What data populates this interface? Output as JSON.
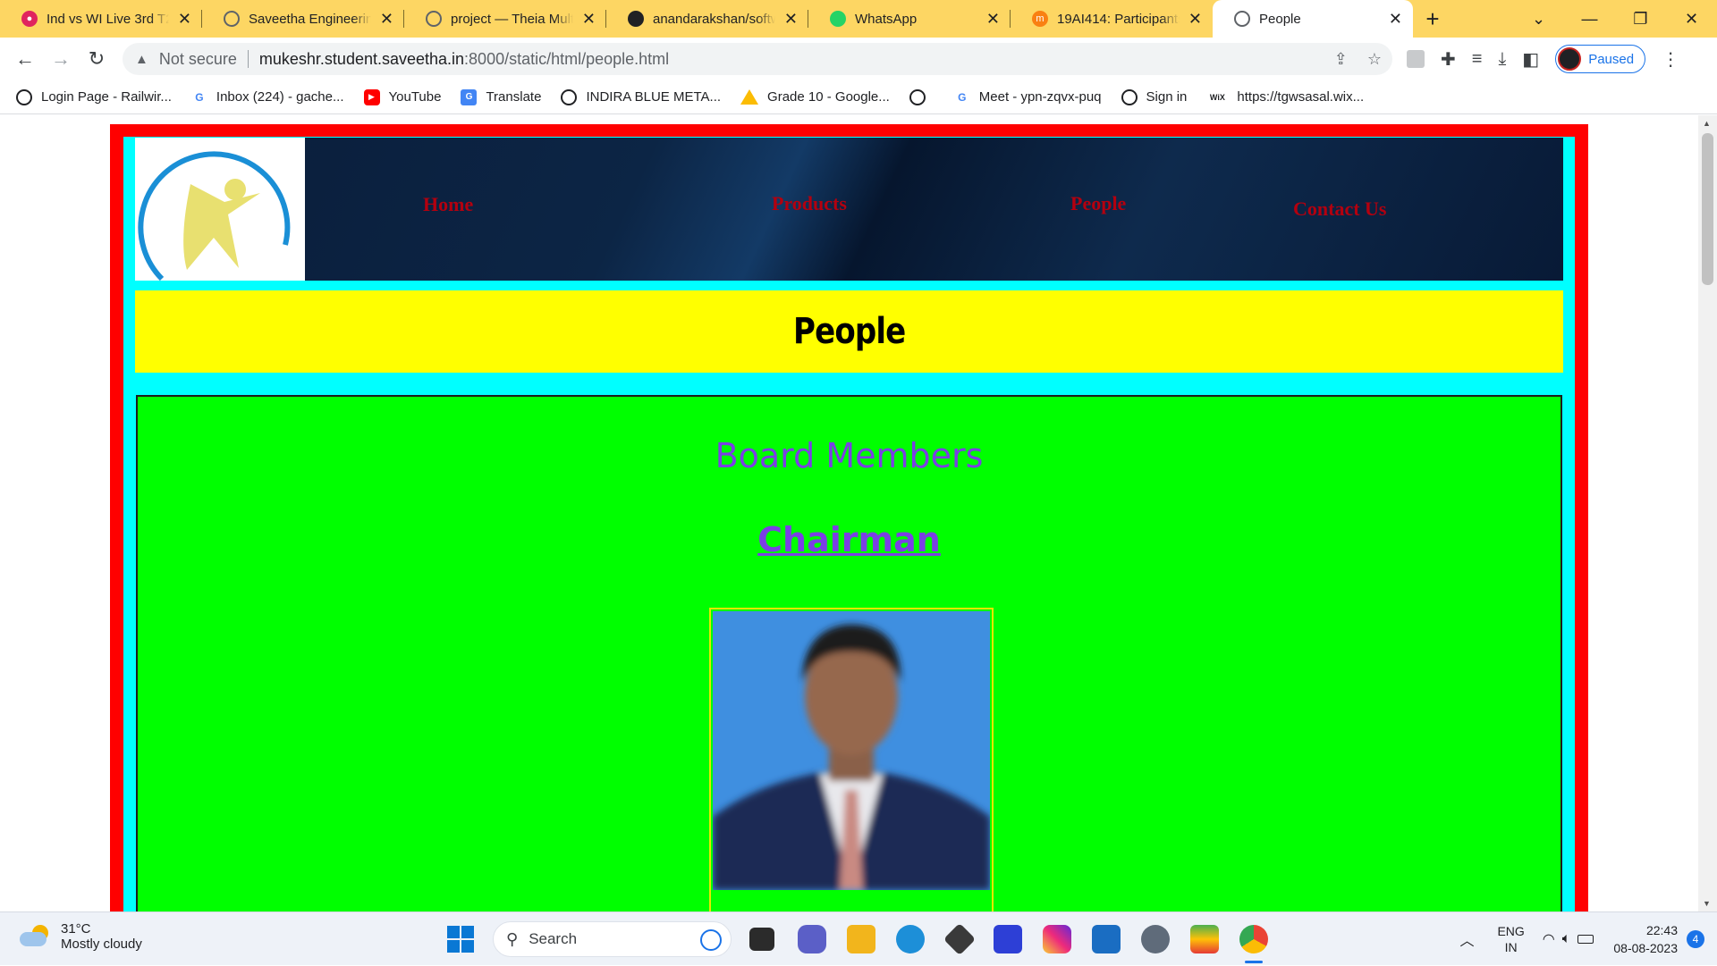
{
  "browser": {
    "tabs": [
      {
        "title": "Ind vs WI Live 3rd T20I",
        "icon": "cricket-icon",
        "color": "#e0245e"
      },
      {
        "title": "Saveetha Engineering",
        "icon": "globe-icon",
        "color": "#5f6368"
      },
      {
        "title": "project — Theia Multi",
        "icon": "globe-icon",
        "color": "#5f6368"
      },
      {
        "title": "anandarakshan/softw",
        "icon": "github-icon",
        "color": "#202124"
      },
      {
        "title": "WhatsApp",
        "icon": "whatsapp-icon",
        "color": "#25d366"
      },
      {
        "title": "19AI414: Participants",
        "icon": "moodle-icon",
        "color": "#f98012"
      },
      {
        "title": "People",
        "icon": "globe-icon",
        "color": "#5f6368"
      }
    ],
    "address": {
      "security_label": "Not secure",
      "host": "mukeshr.student.saveetha.in",
      "path": ":8000/static/html/people.html"
    },
    "profile_label": "Paused",
    "bookmarks": [
      {
        "label": "Login Page - Railwir...",
        "icon": "globe-icon"
      },
      {
        "label": "Inbox (224) - gache...",
        "icon": "google-icon"
      },
      {
        "label": "YouTube",
        "icon": "youtube-icon"
      },
      {
        "label": "Translate",
        "icon": "translate-icon"
      },
      {
        "label": "INDIRA BLUE META...",
        "icon": "globe-icon"
      },
      {
        "label": "Grade 10 - Google...",
        "icon": "drive-icon"
      },
      {
        "label": "",
        "icon": "globe-icon"
      },
      {
        "label": "Meet - ypn-zqvx-puq",
        "icon": "google-icon"
      },
      {
        "label": "Sign in",
        "icon": "globe-icon"
      },
      {
        "label": "https://tgwsasal.wix...",
        "icon": "wix-icon"
      }
    ]
  },
  "page": {
    "nav": {
      "home": "Home",
      "products": "Products",
      "people": "People",
      "contact": "Contact Us"
    },
    "title": "People",
    "section_heading": "Board Members",
    "role_heading": "Chairman",
    "colors": {
      "outer_border": "#ff0000",
      "inner_border": "#00ffff",
      "title_band": "#ffff00",
      "content_bg": "#00ff00",
      "heading_text": "#7b3fe4",
      "nav_text": "#b3000f"
    }
  },
  "taskbar": {
    "weather_temp": "31°C",
    "weather_desc": "Mostly cloudy",
    "search_placeholder": "Search",
    "lang_line1": "ENG",
    "lang_line2": "IN",
    "time": "22:43",
    "date": "08-08-2023",
    "notification_count": "4"
  }
}
